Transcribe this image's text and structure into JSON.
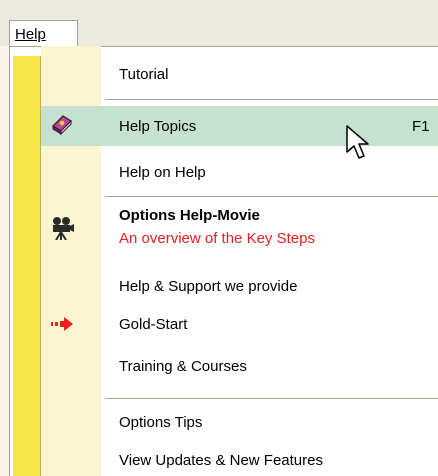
{
  "menubar": {
    "menu_label": "Help"
  },
  "items": [
    {
      "label": "Tutorial"
    },
    {
      "label": "Help Topics",
      "shortcut": "F1",
      "icon": "book-icon"
    },
    {
      "label": "Help on Help"
    },
    {
      "label": "Options Help-Movie",
      "sublabel": "An overview of the Key Steps",
      "icon": "movie-camera-icon"
    },
    {
      "label": "Help & Support we provide"
    },
    {
      "label": "Gold-Start",
      "icon": "red-arrow-icon"
    },
    {
      "label": "Training & Courses"
    },
    {
      "label": "Options Tips"
    },
    {
      "label": "View Updates & New Features"
    }
  ],
  "colors": {
    "highlight": "#c5e1cf",
    "accent_red": "#ee1e1e",
    "sidebar_yellow": "#f7e64a"
  }
}
